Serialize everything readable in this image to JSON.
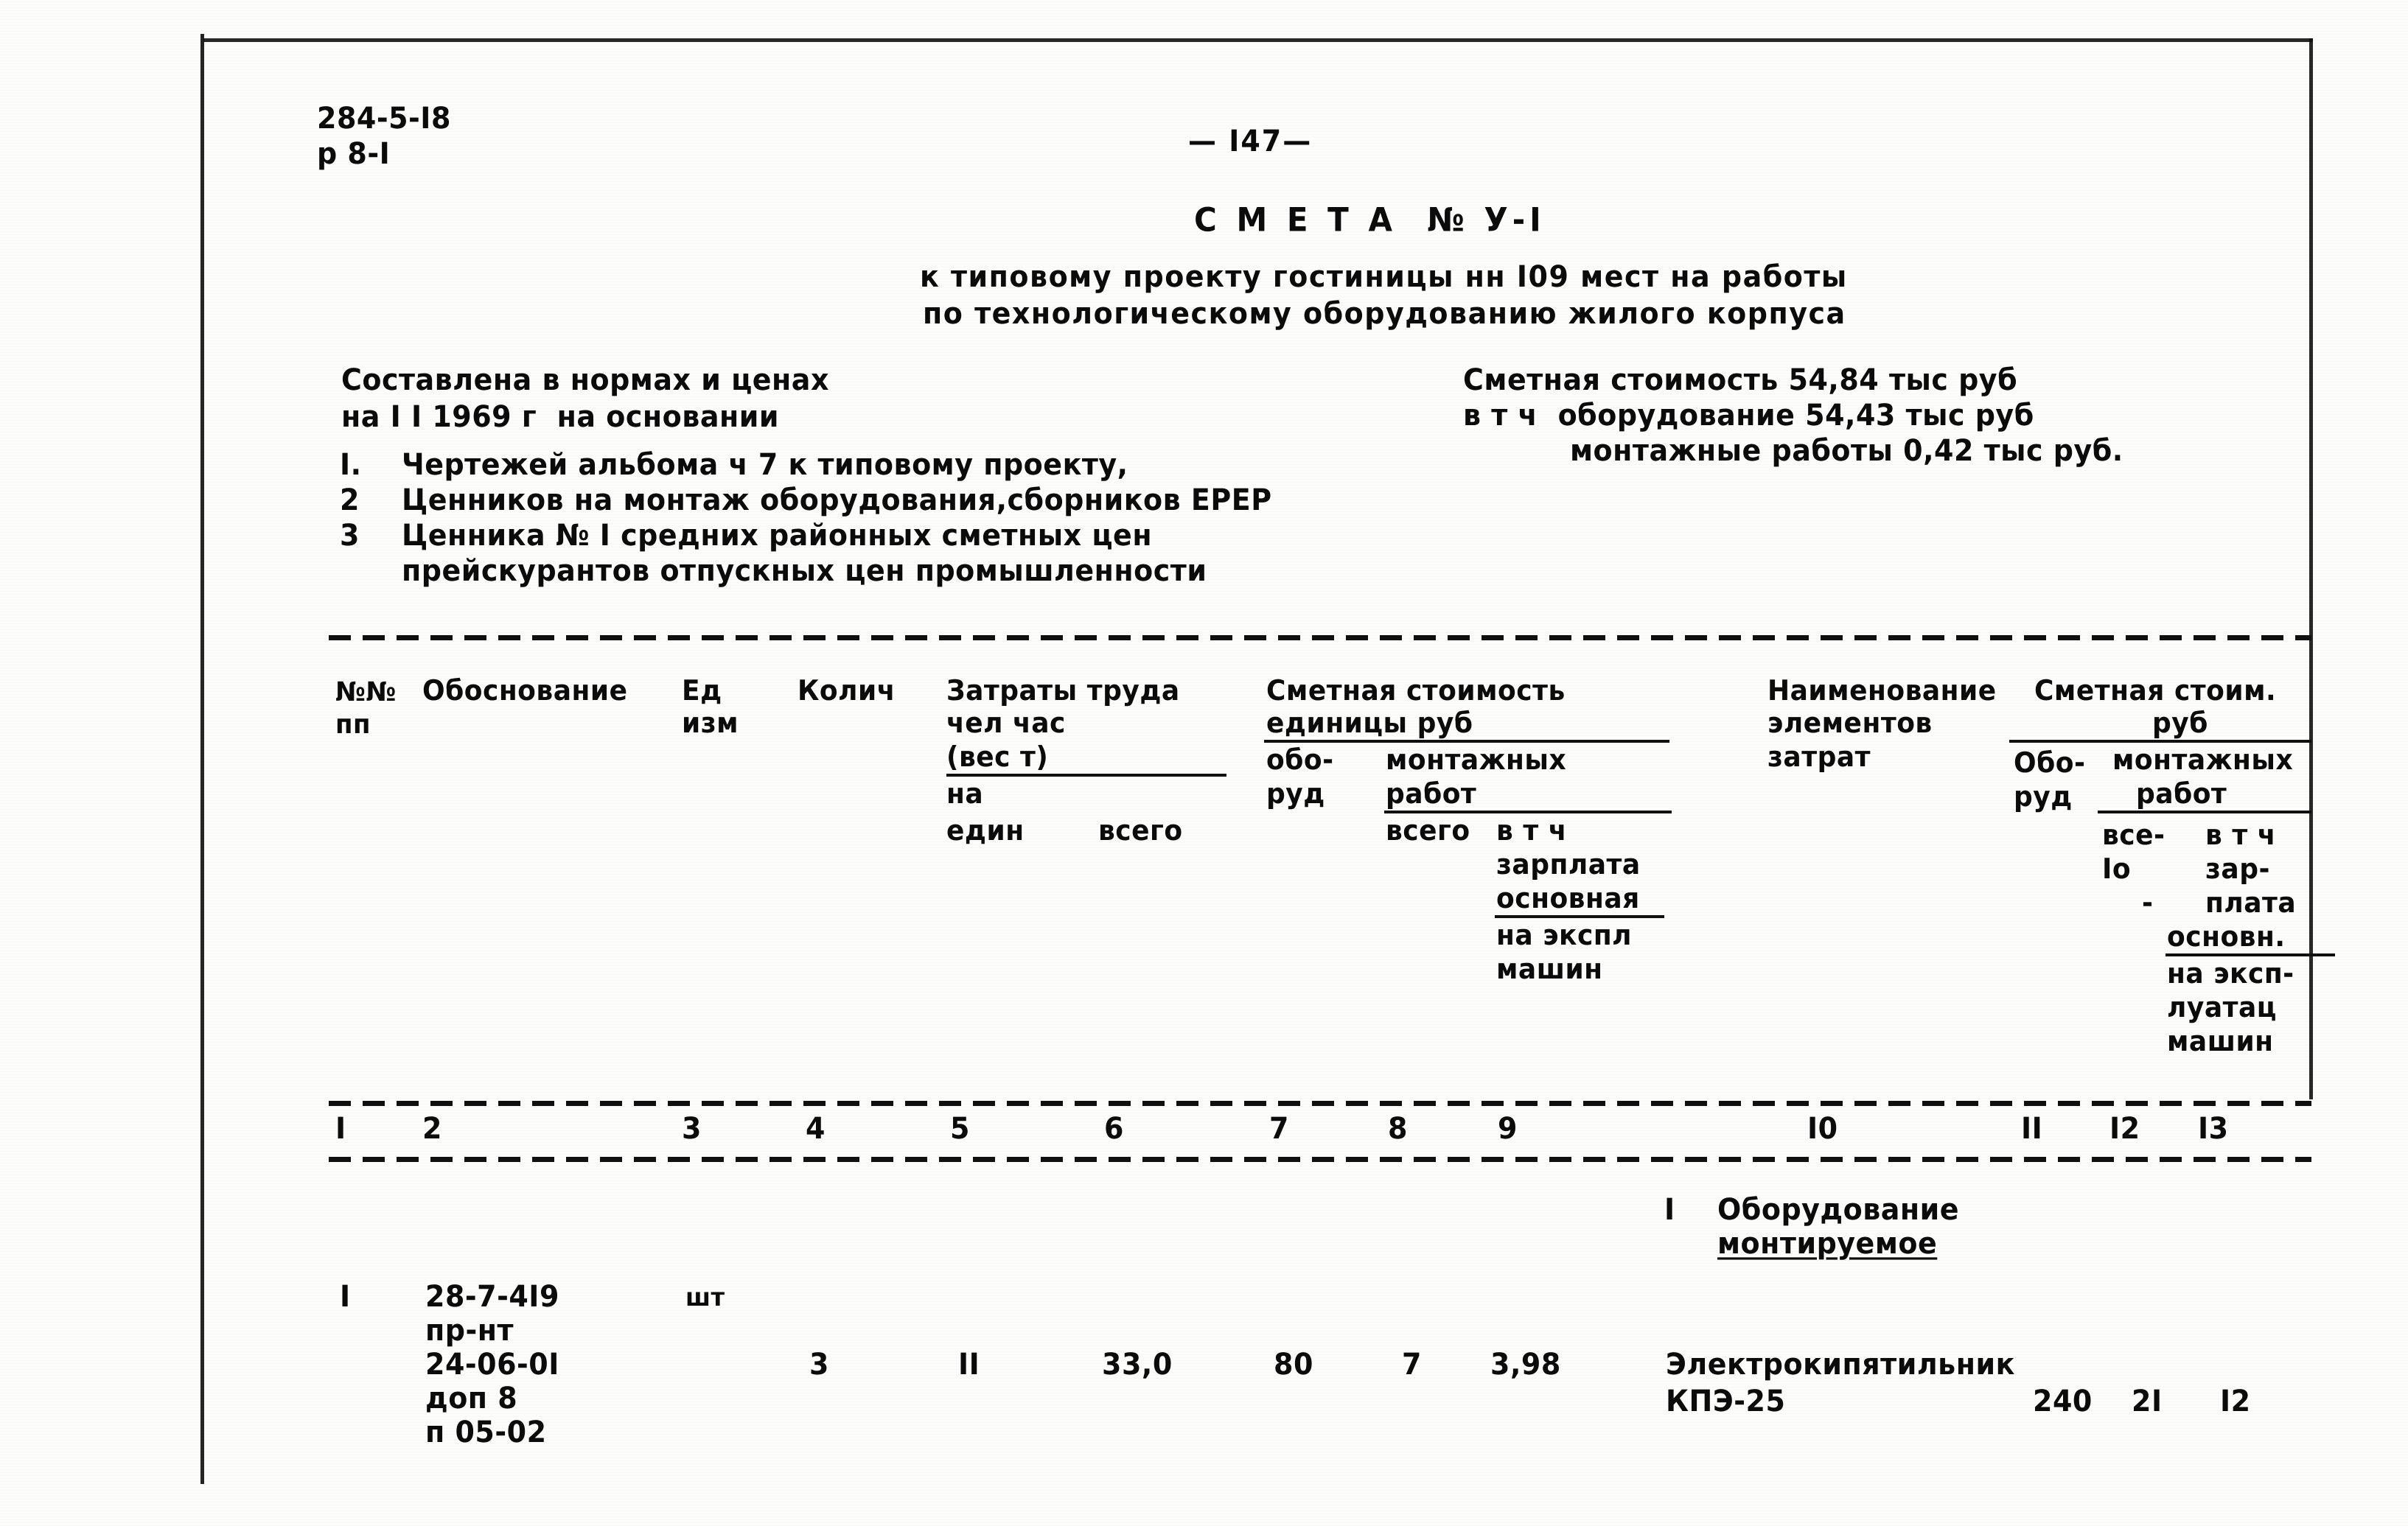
{
  "document": {
    "code_line1": "284-5-I8",
    "code_line2": "р 8-I",
    "page_marker": "— I47—",
    "title": "С М Е Т А  № У-I",
    "subtitle_line1": "к типовому проекту гостиницы нн I09 мест на работы",
    "subtitle_line2": "по технологическому оборудованию жилого корпуса"
  },
  "basis": {
    "line1": "Составлена в нормах и ценах",
    "line2": "на I I 1969 г  на основании",
    "items": [
      {
        "num": "I.",
        "text": "Чертежей альбома ч 7 к типовому проекту,"
      },
      {
        "num": "2",
        "text": "Ценников на монтаж оборудования,сборников ЕРЕР"
      },
      {
        "num": "3",
        "text": "Ценника № I средних районных сметных цен"
      },
      {
        "num": "",
        "text": "прейскурантов отпускных цен промышленности"
      }
    ]
  },
  "cost_summary": {
    "line1": "Сметная стоимость 54,84 тыс руб",
    "line2": "в т ч  оборудование 54,43 тыс руб",
    "line3": "монтажные работы 0,42 тыс руб."
  },
  "table_header": {
    "col1_line1": "№№",
    "col1_line2": "пп",
    "col2": "Обоснование",
    "col3_line1": "Ед",
    "col3_line2": "изм",
    "col4": "Колич",
    "labor_group": {
      "title": "Затраты труда",
      "line2": "чел час",
      "line3": "(вес т)",
      "line4": "на",
      "sub_left": "един",
      "sub_right": "всего"
    },
    "unit_cost_group": {
      "title": "Сметная стоимость",
      "line2": "единицы руб",
      "equip_line1": "обо-",
      "equip_line2": "руд",
      "install_line1": "монтажных",
      "install_line2": "работ",
      "sub_total": "всего",
      "sub_incl": "в т ч",
      "detail1": "зарплата",
      "detail2": "основная",
      "detail3": "на экспл",
      "detail4": "машин"
    },
    "elements_group": {
      "line1": "Наименование",
      "line2": "элементов",
      "line3": "затрат"
    },
    "total_cost_group": {
      "title": "Сметная стоим.",
      "line2": "руб",
      "equip_line1": "Обо-",
      "equip_line2": "руд",
      "install_line1": "монтажных",
      "install_line2": "работ",
      "sub_total_line1": "все-",
      "sub_total_line2": "Iо",
      "sub_total_line3": "-",
      "sub_incl_line1": "в т ч",
      "sub_incl_line2": "зар-",
      "sub_incl_line3": "плата",
      "detail1": "основн.",
      "detail2": "на эксп-",
      "detail3": "луатац",
      "detail4": "машин"
    }
  },
  "column_numbers": [
    "I",
    "2",
    "3",
    "4",
    "5",
    "6",
    "7",
    "8",
    "9",
    "I0",
    "II",
    "I2",
    "I3"
  ],
  "section": {
    "num": "I",
    "line1": "Оборудование",
    "line2": "монтируемое"
  },
  "rows": [
    {
      "num": "I",
      "basis_line1": "28-7-4I9",
      "basis_line2": "пр-нт",
      "basis_line3": "24-06-0I",
      "basis_line4": "доп 8",
      "basis_line5": "п 05-02",
      "unit": "шт",
      "qty": "3",
      "labor_per_unit": "II",
      "labor_total": "33,0",
      "unit_equip": "80",
      "unit_install_total": "7",
      "unit_install_salary": "3,98",
      "element_line1": "Электрокипятильник",
      "element_line2": "КПЭ-25",
      "total_equip": "240",
      "total_install_all": "2I",
      "total_install_incl": "I2"
    }
  ]
}
